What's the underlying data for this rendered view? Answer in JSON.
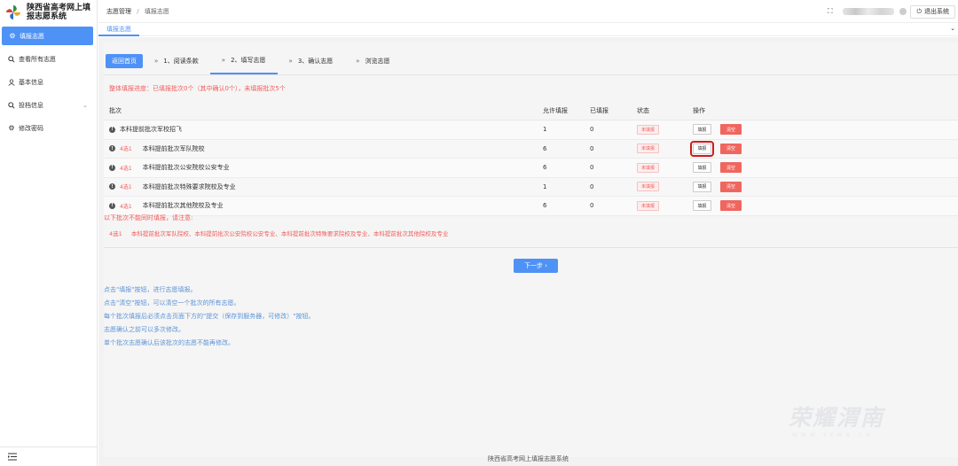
{
  "app": {
    "title_line1": "陕西省高考网上填",
    "title_line2": "报志愿系统"
  },
  "sidebar": {
    "items": [
      {
        "label": "填报志愿",
        "icon": "gear-icon",
        "active": true
      },
      {
        "label": "查看所有志愿",
        "icon": "search-icon"
      },
      {
        "label": "基本信息",
        "icon": "user-icon"
      },
      {
        "label": "投档信息",
        "icon": "search-icon",
        "has_chevron": true
      },
      {
        "label": "修改密码",
        "icon": "gear-icon"
      }
    ],
    "collapse_icon": "menu-collapse-icon"
  },
  "header": {
    "breadcrumb": [
      "志愿管理",
      "填报志愿"
    ],
    "logout_label": "退出系统"
  },
  "tabs": {
    "active": "填报志愿"
  },
  "steps": {
    "home_label": "返回首页",
    "items": [
      "1、阅读条款",
      "2、填写志愿",
      "3、确认志愿",
      "浏览志愿"
    ],
    "active_index": 1
  },
  "progress_text": "整体填报进度：已填报批次0个（其中确认0个），未填报批次5个",
  "table": {
    "headers": [
      "批次",
      "允许填报",
      "已填报",
      "状态",
      "操作"
    ],
    "rows": [
      {
        "group": "",
        "name": "本科提前批次军校招飞",
        "allowed": "1",
        "filled": "0",
        "status": "未填报",
        "fill": "填报",
        "clear": "清空"
      },
      {
        "group": "4选1",
        "name": "本科提前批次军队院校",
        "allowed": "6",
        "filled": "0",
        "status": "未填报",
        "fill": "填报",
        "clear": "清空",
        "highlight": true
      },
      {
        "group": "4选1",
        "name": "本科提前批次公安院校公安专业",
        "allowed": "6",
        "filled": "0",
        "status": "未填报",
        "fill": "填报",
        "clear": "清空"
      },
      {
        "group": "4选1",
        "name": "本科提前批次特殊要求院校及专业",
        "allowed": "1",
        "filled": "0",
        "status": "未填报",
        "fill": "填报",
        "clear": "清空"
      },
      {
        "group": "4选1",
        "name": "本科提前批次其他院校及专业",
        "allowed": "6",
        "filled": "0",
        "status": "未填报",
        "fill": "填报",
        "clear": "清空"
      }
    ]
  },
  "notice": {
    "title": "以下批次不能同时填报，请注意:",
    "tag": "4选1",
    "text": "本科提前批次军队院校、本科提前批次公安院校公安专业、本科提前批次特殊要求院校及专业、本科提前批次其他院校及专业"
  },
  "next_label": "下一步 ›",
  "tips": [
    "点击\"填报\"按钮，进行志愿填报。",
    "点击\"清空\"按钮，可以清空一个批次的所有志愿。",
    "每个批次填报后必须点击页面下方的\"提交（保存到服务器，可修改）\"按钮。",
    "志愿确认之前可以多次修改。",
    "单个批次志愿确认后该批次的志愿不能再修改。"
  ],
  "watermark": {
    "big": "荣耀渭南",
    "small": "WWW.YEWN.CN"
  },
  "footer": "陕西省高考网上填报志愿系统",
  "colors": {
    "accent": "#4f92f6",
    "danger": "#f0665f",
    "tip": "#5c93d8"
  }
}
